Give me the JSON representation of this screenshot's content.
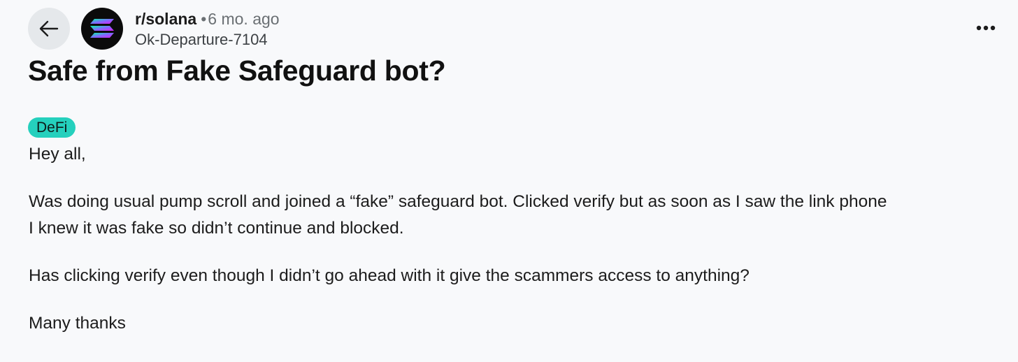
{
  "post": {
    "subreddit": "r/solana",
    "separator": "•",
    "age": "6 mo. ago",
    "author": "Ok-Departure-7104",
    "title": "Safe from Fake Safeguard bot?",
    "flair": "DeFi",
    "flair_color": "#25d0bd",
    "paragraphs": {
      "greeting": "Hey all,",
      "p1_line1": "Was doing usual pump scroll and joined a “fake” safeguard bot. Clicked verify but as soon as I saw the link phone",
      "p1_line2": "I knew it was fake so didn’t continue and blocked.",
      "p2": "Has clicking verify even though I didn’t go ahead with it give the scammers access to anything?",
      "signoff": "Many thanks"
    }
  },
  "icons": {
    "back": "back-arrow-icon",
    "avatar": "solana-logo-icon",
    "more": "more-options-icon"
  }
}
